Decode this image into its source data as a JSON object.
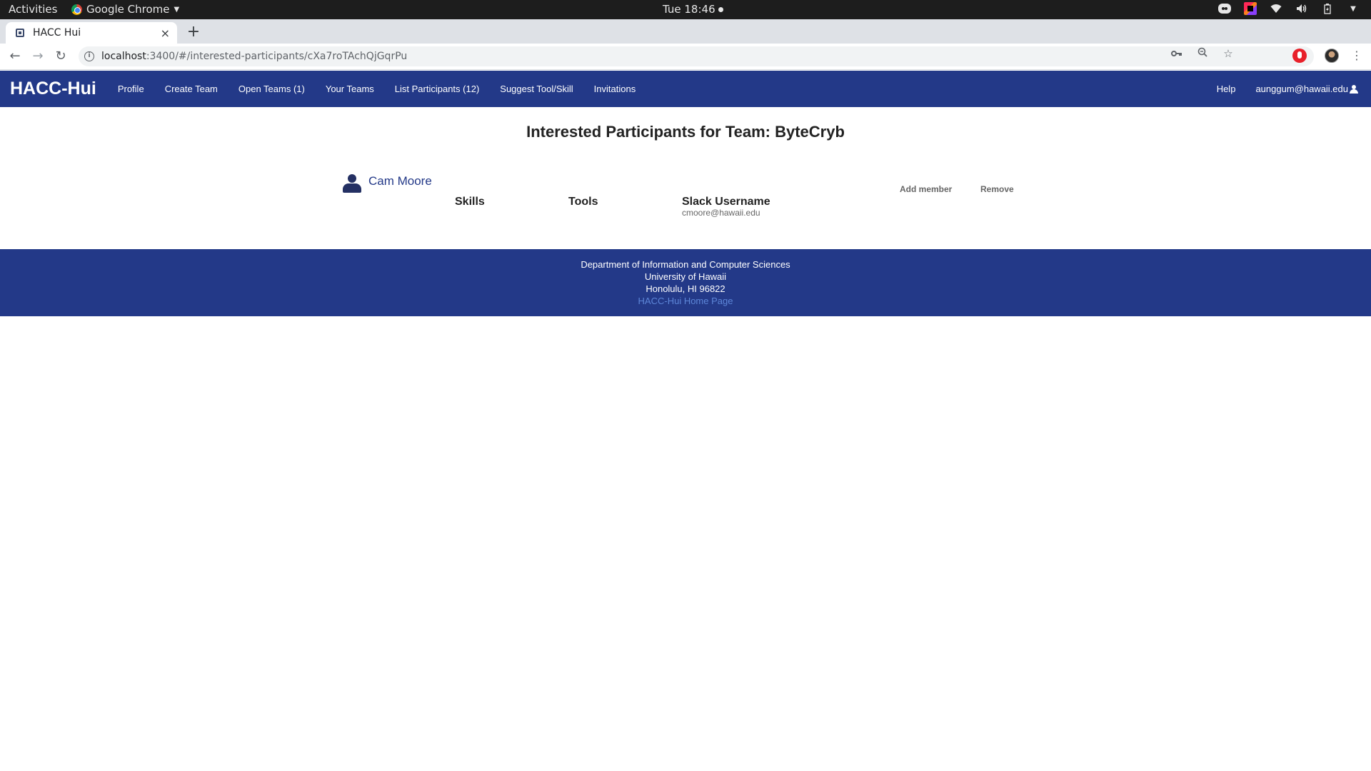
{
  "system_bar": {
    "activities": "Activities",
    "app_name": "Google Chrome",
    "clock": "Tue 18:46"
  },
  "browser": {
    "tab_title": "HACC Hui",
    "tab_close": "×",
    "new_tab": "+",
    "url_host": "localhost",
    "url_path": ":3400/#/interested-participants/cXa7roTAchQjGqrPu"
  },
  "navbar": {
    "brand": "HACC-Hui",
    "links": [
      "Profile",
      "Create Team",
      "Open Teams (1)",
      "Your Teams",
      "List Participants (12)",
      "Suggest Tool/Skill",
      "Invitations"
    ],
    "help": "Help",
    "user": "aunggum@hawaii.edu"
  },
  "main": {
    "title": "Interested Participants for Team: ByteCryb",
    "participant": {
      "name": "Cam Moore",
      "skills_label": "Skills",
      "tools_label": "Tools",
      "slack_label": "Slack Username",
      "slack_value": "cmoore@hawaii.edu",
      "add_label": "Add member",
      "remove_label": "Remove"
    }
  },
  "footer": {
    "line1": "Department of Information and Computer Sciences",
    "line2": "University of Hawaii",
    "line3": "Honolulu, HI 96822",
    "link": "HACC-Hui Home Page"
  },
  "colors": {
    "navbar": "#233988",
    "footer": "#233988",
    "link": "#5d86d8"
  }
}
